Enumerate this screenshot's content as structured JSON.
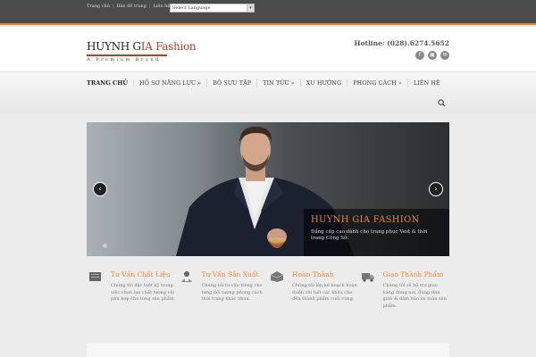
{
  "topbar": {
    "links": [
      "Trang chủ",
      "Bản đồ trang",
      "Liên hệ"
    ],
    "language_select": "Select Language"
  },
  "header": {
    "logo_text_a": "HUYNH G",
    "logo_text_b": "IA",
    "logo_text_c": " Fashion",
    "logo_tagline": "A Premium Brand",
    "hotline": "Hotline: (028).6274.5652",
    "socials": [
      "f",
      "▣",
      "✉"
    ]
  },
  "nav": {
    "items": [
      "TRANG CHỦ",
      "HỒ SƠ NĂNG LỰC »",
      "BỘ SƯU TẬP",
      "TIN TỨC »",
      "XU HƯỚNG",
      "PHONG CÁCH »",
      "LIÊN HỆ"
    ],
    "search_icon": "search-icon"
  },
  "slider": {
    "caption_title": "HUYNH GIA FASHION",
    "caption_desc": "Đẳng cấp cao dành cho trang phục Vest & thời trang Công Sở.",
    "prev": "‹",
    "next": "›"
  },
  "features": [
    {
      "title": "Tư Vấn Chất Liệu",
      "desc": "Chúng tôi đặc biệt kỹ trong việc chọn lựa chất lượng vải phù hợp cho từng sản phẩm.",
      "icon": "fabric-icon"
    },
    {
      "title": "Tư Vấn Sản Xuất",
      "desc": "Chúng tôi tư vấn riêng cho từng đối tượng phong cách thời trang khác nhau.",
      "icon": "tailor-icon"
    },
    {
      "title": "Hoàn Thành",
      "desc": "Chúng tôi lên kế hoạch hoàn thiện chi tiết các khâu cho đến thành phẩm cuối cùng.",
      "icon": "finish-icon"
    },
    {
      "title": "Giao Thành Phẩm",
      "desc": "Chúng tôi sẽ hỗ trợ giao hàng đúng nơi, đúng thời gian & đảm bảo an toàn sản phẩm.",
      "icon": "delivery-icon"
    }
  ],
  "colors": {
    "accent": "#e8872c",
    "logo_red": "#c0392b",
    "topbar": "#4b4b4b"
  }
}
